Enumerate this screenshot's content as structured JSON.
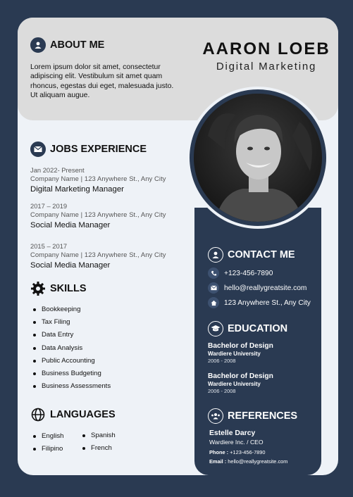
{
  "header": {
    "name": "AARON LOEB",
    "role": "Digital Marketing"
  },
  "about": {
    "heading": "ABOUT ME",
    "text": "Lorem ipsum dolor sit amet, consectetur adipiscing elit. Vestibulum sit amet quam rhoncus, egestas dui eget, malesuada justo. Ut aliquam augue."
  },
  "jobs": {
    "heading": "JOBS EXPERIENCE",
    "items": [
      {
        "date": "Jan 2022- Present",
        "company": "Company Name | 123 Anywhere St., Any City",
        "title": "Digital Marketing Manager"
      },
      {
        "date": "2017 – 2019",
        "company": "Company Name | 123 Anywhere St., Any City",
        "title": "Social Media Manager"
      },
      {
        "date": "2015 – 2017",
        "company": "Company Name | 123 Anywhere St., Any City",
        "title": "Social Media Manager"
      }
    ]
  },
  "skills": {
    "heading": "SKILLS",
    "items": [
      "Bookkeeping",
      "Tax Filing",
      "Data Entry",
      "Data Analysis",
      "Public Accounting",
      "Business Budgeting",
      "Business Assessments"
    ]
  },
  "languages": {
    "heading": "LANGUAGES",
    "col1": [
      "English",
      "Filipino"
    ],
    "col2": [
      "Spanish",
      "French"
    ]
  },
  "contact": {
    "heading": "CONTACT ME",
    "phone": "+123-456-7890",
    "email": "hello@reallygreatsite.com",
    "address": "123 Anywhere St., Any City"
  },
  "education": {
    "heading": "EDUCATION",
    "items": [
      {
        "degree": "Bachelor of Design",
        "school": "Wardiere University",
        "years": "2006 - 2008"
      },
      {
        "degree": "Bachelor of Design",
        "school": "Wardiere University",
        "years": "2006 - 2008"
      }
    ]
  },
  "references": {
    "heading": "REFERENCES",
    "name": "Estelle Darcy",
    "org": "Wardiere Inc. / CEO",
    "phone_label": "Phone :",
    "phone": "+123-456-7890",
    "email_label": "Email :",
    "email": "hello@reallygreatsite.com"
  },
  "colors": {
    "navy": "#2a3a52",
    "light": "#eef2f7",
    "band": "#dcdcdc"
  },
  "icons": [
    "user-icon",
    "mail-icon",
    "gear-icon",
    "globe-icon",
    "phone-icon",
    "home-icon",
    "graduation-cap-icon",
    "group-icon"
  ]
}
